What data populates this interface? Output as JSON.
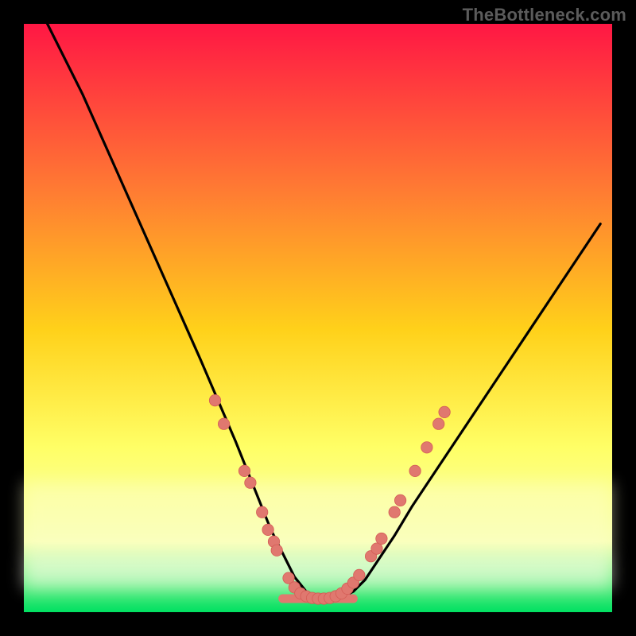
{
  "watermark": "TheBottleneck.com",
  "colors": {
    "black": "#000000",
    "curve": "#000000",
    "grad_top": "#ff1744",
    "grad_mid_upper": "#ff7a33",
    "grad_mid": "#ffd11a",
    "grad_mid_lower": "#ffff66",
    "grad_lower": "#f6ffb0",
    "grad_bottom": "#00e062",
    "dots": "#e0786f",
    "dot_stroke": "#d45d56",
    "pale_band": "#ffffcc",
    "white_band": "#fffff0"
  },
  "chart_data": {
    "type": "line",
    "title": "",
    "xlabel": "",
    "ylabel": "",
    "xlim": [
      0,
      100
    ],
    "ylim": [
      0,
      100
    ],
    "series": [
      {
        "name": "bottleneck-curve",
        "x": [
          4,
          6,
          10,
          14,
          18,
          22,
          26,
          30,
          33,
          36,
          38,
          40,
          42,
          44,
          46,
          48,
          50,
          52,
          54,
          56,
          58,
          60,
          63,
          66,
          70,
          74,
          78,
          82,
          86,
          90,
          94,
          98
        ],
        "y": [
          100,
          96,
          88,
          79,
          70,
          61,
          52,
          43,
          36,
          29,
          24,
          19,
          14,
          10,
          6,
          3.5,
          2.5,
          2.3,
          2.5,
          3.5,
          5.5,
          8.5,
          13,
          18,
          24,
          30,
          36,
          42,
          48,
          54,
          60,
          66
        ]
      }
    ],
    "flat_bottom": {
      "x_start": 44,
      "x_end": 56,
      "y": 2.3
    },
    "scatter_dots": [
      {
        "x": 32.5,
        "y": 36
      },
      {
        "x": 34.0,
        "y": 32
      },
      {
        "x": 37.5,
        "y": 24
      },
      {
        "x": 38.5,
        "y": 22
      },
      {
        "x": 40.5,
        "y": 17
      },
      {
        "x": 41.5,
        "y": 14
      },
      {
        "x": 42.5,
        "y": 12
      },
      {
        "x": 43.0,
        "y": 10.5
      },
      {
        "x": 45.0,
        "y": 5.8
      },
      {
        "x": 46.0,
        "y": 4.2
      },
      {
        "x": 47.0,
        "y": 3.2
      },
      {
        "x": 48.0,
        "y": 2.7
      },
      {
        "x": 49.0,
        "y": 2.4
      },
      {
        "x": 50.0,
        "y": 2.3
      },
      {
        "x": 51.0,
        "y": 2.3
      },
      {
        "x": 52.0,
        "y": 2.4
      },
      {
        "x": 53.0,
        "y": 2.7
      },
      {
        "x": 54.0,
        "y": 3.2
      },
      {
        "x": 55.0,
        "y": 4.0
      },
      {
        "x": 56.0,
        "y": 5.0
      },
      {
        "x": 57.0,
        "y": 6.3
      },
      {
        "x": 59.0,
        "y": 9.5
      },
      {
        "x": 60.0,
        "y": 10.8
      },
      {
        "x": 60.8,
        "y": 12.5
      },
      {
        "x": 63.0,
        "y": 17
      },
      {
        "x": 64.0,
        "y": 19
      },
      {
        "x": 66.5,
        "y": 24
      },
      {
        "x": 68.5,
        "y": 28
      },
      {
        "x": 70.5,
        "y": 32
      },
      {
        "x": 71.5,
        "y": 34
      }
    ],
    "bands": [
      {
        "name": "pale-yellow-band",
        "y_top": 22,
        "y_bottom": 10
      },
      {
        "name": "white-band",
        "y_top": 10,
        "y_bottom": 4
      }
    ]
  }
}
